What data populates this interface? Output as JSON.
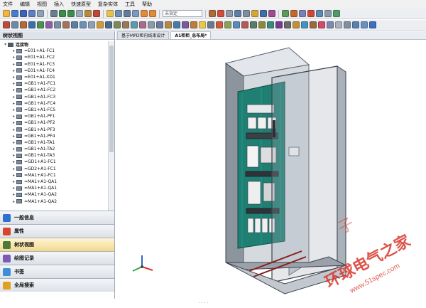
{
  "menu": [
    "文件",
    "编辑",
    "视图",
    "插入",
    "快速原型",
    "复杂实体",
    "工具",
    "帮助"
  ],
  "toolbar": {
    "combo_value": "未指定"
  },
  "left_panel": {
    "title": "树状视图",
    "root_label": "连接物",
    "items": [
      "=E01+A1-FC1",
      "=E01+A1-FC2",
      "=E01+A1-FC3",
      "=E01+A1-FC4",
      "=E01+A1-XD1",
      "=GB1+A1-FC1",
      "=GB1+A1-FC2",
      "=GB1+A1-FC3",
      "=GB1+A1-FC4",
      "=GB1+A1-FC5",
      "=GB1+A1-PF1",
      "=GB1+A1-PF2",
      "=GB1+A1-PF3",
      "=GB1+A1-PF4",
      "=GB1+A1-TA1",
      "=GB1+A1-TA2",
      "=GB1+A1-TA3",
      "=GD1+A1-FC1",
      "=GD2+A1-FC1",
      "=MA1+A1-FC1",
      "=MA1+A1-QA1",
      "=MA1+A1-QA1",
      "=MA1+A1-QA2",
      "=MA1+A1-QA2"
    ]
  },
  "nav_panels": [
    {
      "label": "一般信息",
      "icon": "info-icon",
      "color": "#2f6fd0"
    },
    {
      "label": "属性",
      "icon": "properties-icon",
      "color": "#d8452d"
    },
    {
      "label": "树状视图",
      "icon": "tree-view-icon",
      "color": "#4b7a3a",
      "active": true
    },
    {
      "label": "绘图记录",
      "icon": "drawing-history-icon",
      "color": "#7a5cb8"
    },
    {
      "label": "书签",
      "icon": "bookmark-icon",
      "color": "#3c8fd6"
    },
    {
      "label": "全局搜索",
      "icon": "search-icon",
      "color": "#e0a020"
    }
  ],
  "doc_tabs": [
    {
      "label": "基于MPD柜内线束设计"
    },
    {
      "label": "A1柜柜_总布局*",
      "active": true
    }
  ],
  "watermark": {
    "primary": "环球电气之家",
    "url": "www.51spec.com",
    "partial": "子"
  },
  "status_text": "· ·  ·  ·",
  "colors": {
    "cabinet_frame": "#5b6470",
    "mounting_plate": "#1f7f73",
    "watermark_red": "#d8362b"
  }
}
